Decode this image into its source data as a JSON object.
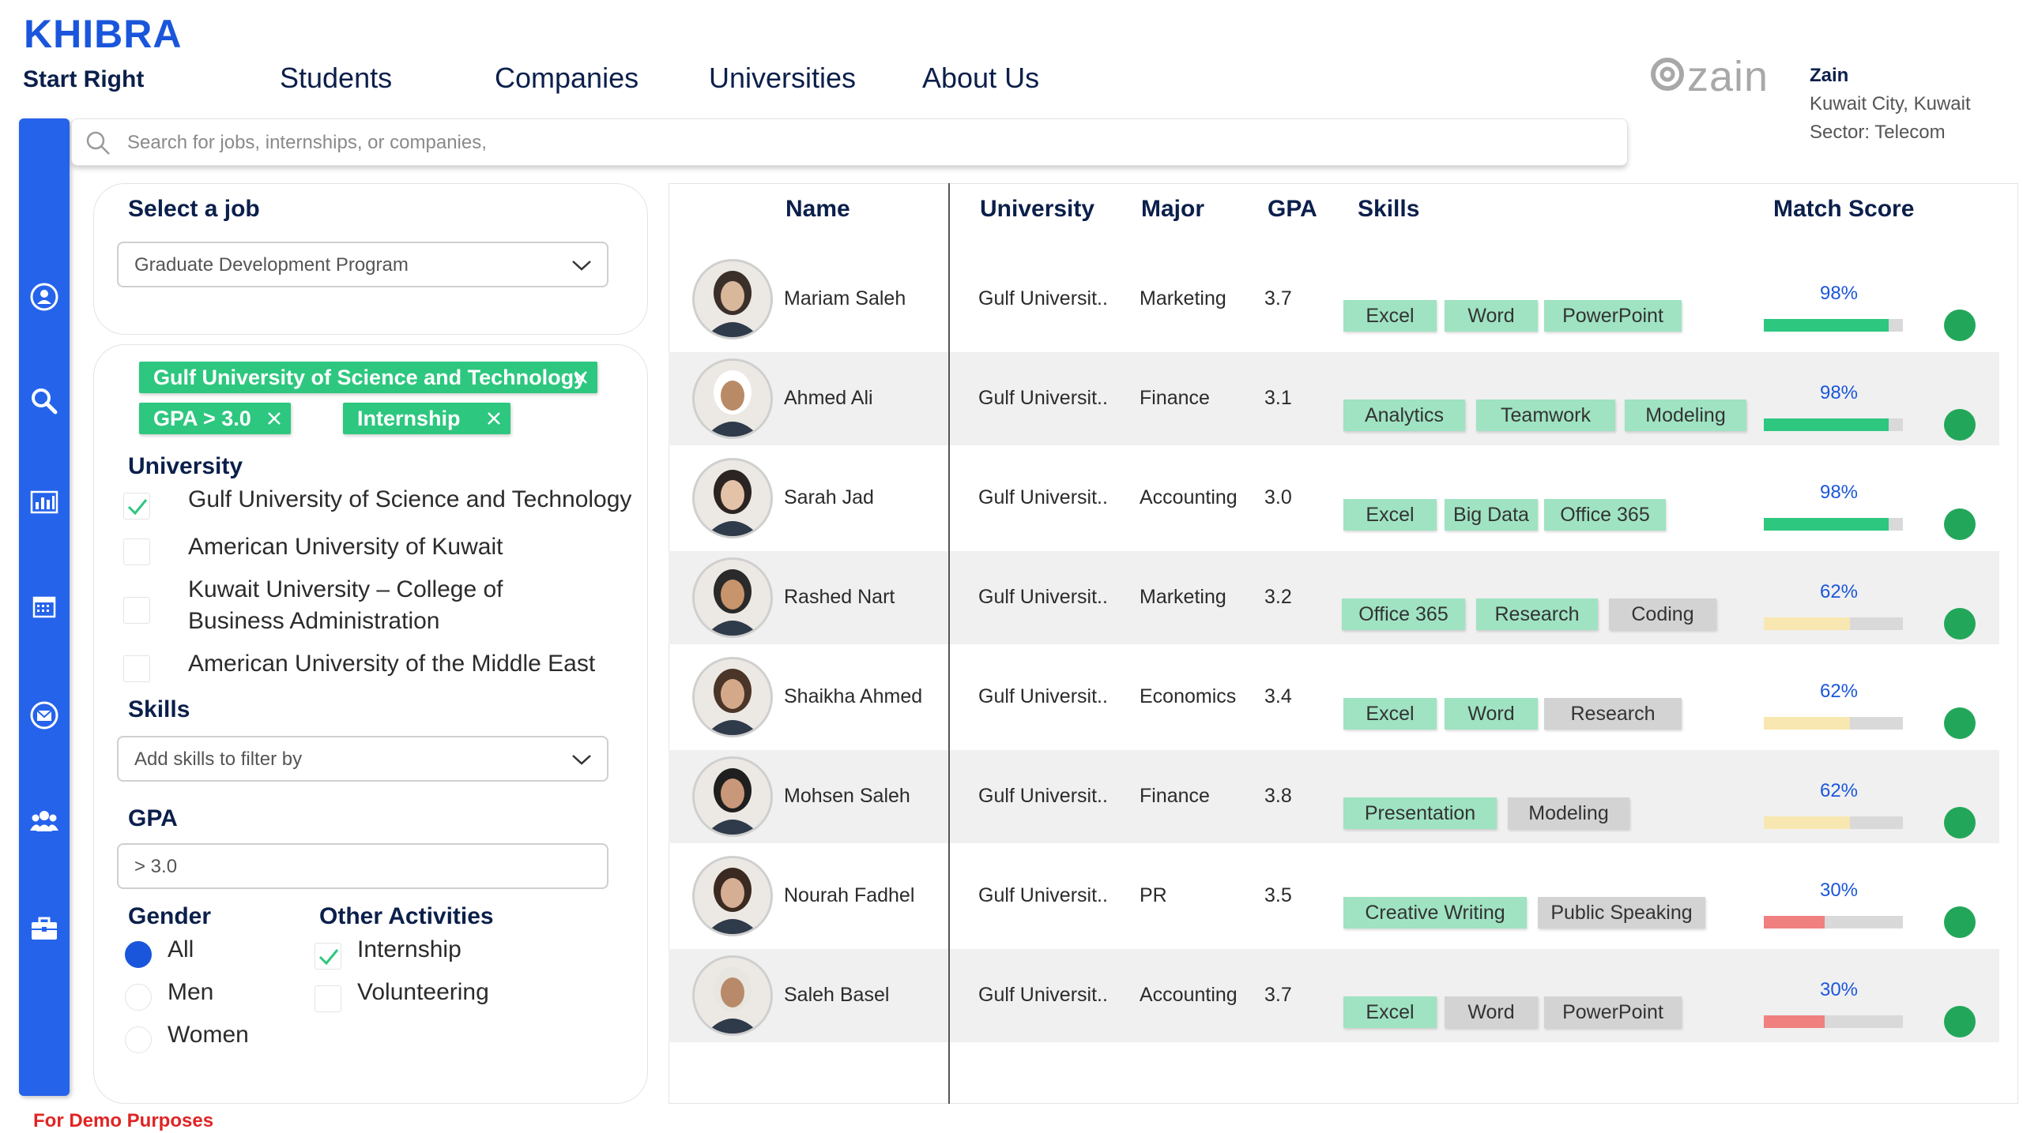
{
  "header": {
    "brand": "KHIBRA",
    "tagline": "Start Right",
    "nav": [
      "Students",
      "Companies",
      "Universities",
      "About Us"
    ]
  },
  "company": {
    "logo_text": "zain",
    "name": "Zain",
    "location": "Kuwait City, Kuwait",
    "sector": "Sector: Telecom"
  },
  "sidebar": {
    "icons": [
      "user-icon",
      "search-icon",
      "dashboard-icon",
      "calendar-icon",
      "mail-icon",
      "group-icon",
      "briefcase-icon"
    ],
    "color": "#2563eb"
  },
  "search": {
    "placeholder": "Search for jobs, internships, or companies,"
  },
  "filters": {
    "select_job_title": "Select a job",
    "selected_job": "Graduate Development Program",
    "chips": [
      "Gulf University of Science and Technology",
      "GPA > 3.0",
      "Internship"
    ],
    "university_title": "University",
    "universities": [
      {
        "label": "Gulf University of Science and Technology",
        "checked": true
      },
      {
        "label": "American University of Kuwait",
        "checked": false
      },
      {
        "label": "Kuwait University – College of",
        "label2": "Business Administration",
        "checked": false
      },
      {
        "label": "American University of the Middle East",
        "checked": false
      }
    ],
    "skills_title": "Skills",
    "skills_placeholder": "Add skills to filter by",
    "gpa_title": "GPA",
    "gpa_value": "> 3.0",
    "gender_title": "Gender",
    "genders": [
      {
        "label": "All",
        "selected": true
      },
      {
        "label": "Men",
        "selected": false
      },
      {
        "label": "Women",
        "selected": false
      }
    ],
    "activities_title": "Other Activities",
    "activities": [
      {
        "label": "Internship",
        "checked": true
      },
      {
        "label": "Volunteering",
        "checked": false
      }
    ]
  },
  "table": {
    "columns": [
      "Name",
      "University",
      "Major",
      "GPA",
      "Skills",
      "Match Score"
    ],
    "rows": [
      {
        "name": "Mariam Saleh",
        "university": "Gulf Universit..",
        "major": "Marketing",
        "gpa": "3.7",
        "skills": [
          {
            "label": "Excel",
            "style": "green"
          },
          {
            "label": "Word",
            "style": "green"
          },
          {
            "label": "PowerPoint",
            "style": "green"
          }
        ],
        "match": "98%",
        "match_value": 0.9,
        "match_color": "#2dc77f"
      },
      {
        "name": "Ahmed Ali",
        "university": "Gulf Universit..",
        "major": "Finance",
        "gpa": "3.1",
        "skills": [
          {
            "label": "Analytics",
            "style": "green"
          },
          {
            "label": "Teamwork",
            "style": "green"
          },
          {
            "label": "Modeling",
            "style": "green"
          }
        ],
        "match": "98%",
        "match_value": 0.9,
        "match_color": "#2dc77f"
      },
      {
        "name": "Sarah Jad",
        "university": "Gulf Universit..",
        "major": "Accounting",
        "gpa": "3.0",
        "skills": [
          {
            "label": "Excel",
            "style": "green"
          },
          {
            "label": "Big Data",
            "style": "green"
          },
          {
            "label": "Office 365",
            "style": "green"
          }
        ],
        "match": "98%",
        "match_value": 0.9,
        "match_color": "#2dc77f"
      },
      {
        "name": "Rashed Nart",
        "university": "Gulf Universit..",
        "major": "Marketing",
        "gpa": "3.2",
        "skills": [
          {
            "label": "Office 365",
            "style": "green"
          },
          {
            "label": "Research",
            "style": "green"
          },
          {
            "label": "Coding",
            "style": "grey"
          }
        ],
        "match": "62%",
        "match_value": 0.62,
        "match_color": "#f8e7b0"
      },
      {
        "name": "Shaikha Ahmed",
        "university": "Gulf Universit..",
        "major": "Economics",
        "gpa": "3.4",
        "skills": [
          {
            "label": "Excel",
            "style": "green"
          },
          {
            "label": "Word",
            "style": "green"
          },
          {
            "label": "Research",
            "style": "grey"
          }
        ],
        "match": "62%",
        "match_value": 0.62,
        "match_color": "#f8e7b0"
      },
      {
        "name": "Mohsen Saleh",
        "university": "Gulf Universit..",
        "major": "Finance",
        "gpa": "3.8",
        "skills": [
          {
            "label": "Presentation",
            "style": "green"
          },
          {
            "label": "Modeling",
            "style": "grey"
          }
        ],
        "match": "62%",
        "match_value": 0.62,
        "match_color": "#f8e7b0"
      },
      {
        "name": "Nourah Fadhel",
        "university": "Gulf Universit..",
        "major": "PR",
        "gpa": "3.5",
        "skills": [
          {
            "label": "Creative Writing",
            "style": "green"
          },
          {
            "label": "Public Speaking",
            "style": "grey"
          }
        ],
        "match": "30%",
        "match_value": 0.44,
        "match_color": "#f08080"
      },
      {
        "name": "Saleh Basel",
        "university": "Gulf Universit..",
        "major": "Accounting",
        "gpa": "3.7",
        "skills": [
          {
            "label": "Excel",
            "style": "green"
          },
          {
            "label": "Word",
            "style": "grey"
          },
          {
            "label": "PowerPoint",
            "style": "grey"
          }
        ],
        "match": "30%",
        "match_value": 0.44,
        "match_color": "#f08080"
      }
    ]
  },
  "footer": {
    "demo_note": "For Demo Purposes"
  }
}
